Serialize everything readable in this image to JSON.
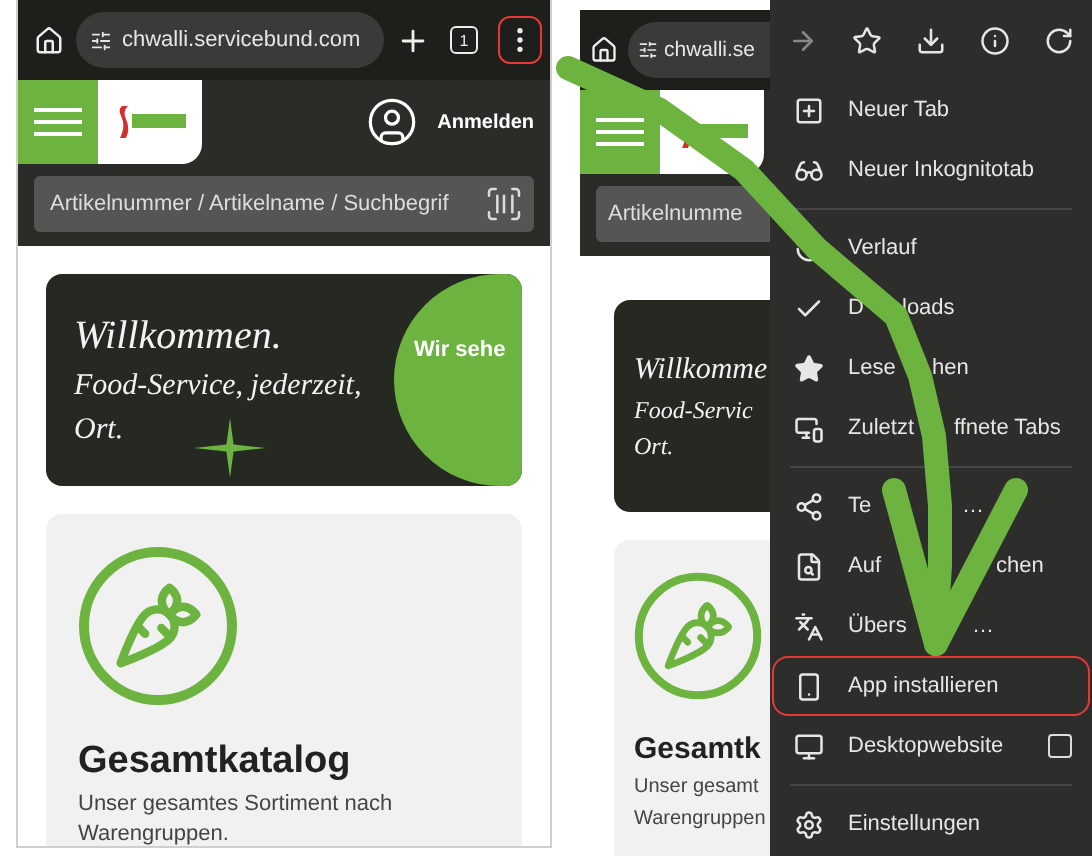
{
  "left_phone": {
    "toolbar": {
      "url": "chwalli.servicebund.com",
      "tab_count": "1",
      "menu_highlighted": true
    },
    "header": {
      "login": "Anmelden"
    },
    "search": {
      "placeholder": "Artikelnummer / Artikelname / Suchbegrif"
    },
    "banner": {
      "lines": [
        "Willkommen.",
        "Food-Service, jederzeit,",
        "Ort."
      ],
      "badge": "Wir sehe"
    },
    "card": {
      "title": "Gesamtkatalog",
      "text": "Unser gesamtes Sortiment nach Warengruppen."
    }
  },
  "right_phone": {
    "url": "chwalli.se",
    "search": {
      "placeholder": "Artikelnumme"
    },
    "banner_lines": [
      "Willkomme",
      "Food-Servic",
      "Ort."
    ],
    "card_title": "Gesamtk",
    "card_lines": [
      "Unser gesamt",
      "Warengruppen"
    ],
    "menu": {
      "items": [
        {
          "kind": "item",
          "parts": [
            "Neuer Tab"
          ],
          "highlighted": false
        },
        {
          "kind": "item",
          "parts": [
            "Neuer Inkognitotab"
          ],
          "highlighted": false
        },
        {
          "kind": "divider"
        },
        {
          "kind": "item",
          "parts": [
            "Verlauf"
          ],
          "highlighted": false
        },
        {
          "kind": "item",
          "parts": [
            "D",
            "loads"
          ],
          "highlighted": false
        },
        {
          "kind": "item",
          "parts": [
            "Lese",
            "hen"
          ],
          "highlighted": false
        },
        {
          "kind": "item",
          "parts": [
            "Zuletzt",
            "ffnete Tabs"
          ],
          "highlighted": false
        },
        {
          "kind": "divider"
        },
        {
          "kind": "item",
          "parts": [
            "Te",
            "…"
          ],
          "highlighted": false
        },
        {
          "kind": "item",
          "parts": [
            "Auf",
            "chen"
          ],
          "highlighted": false
        },
        {
          "kind": "item",
          "parts": [
            "Übers",
            "…"
          ],
          "highlighted": false
        },
        {
          "kind": "item",
          "parts": [
            "App installieren"
          ],
          "highlighted": true
        },
        {
          "kind": "checkbox",
          "parts": [
            "Desktopwebsite"
          ],
          "checked": false,
          "highlighted": false
        },
        {
          "kind": "divider"
        },
        {
          "kind": "item",
          "parts": [
            "Einstellungen"
          ],
          "highlighted": false
        }
      ]
    }
  }
}
